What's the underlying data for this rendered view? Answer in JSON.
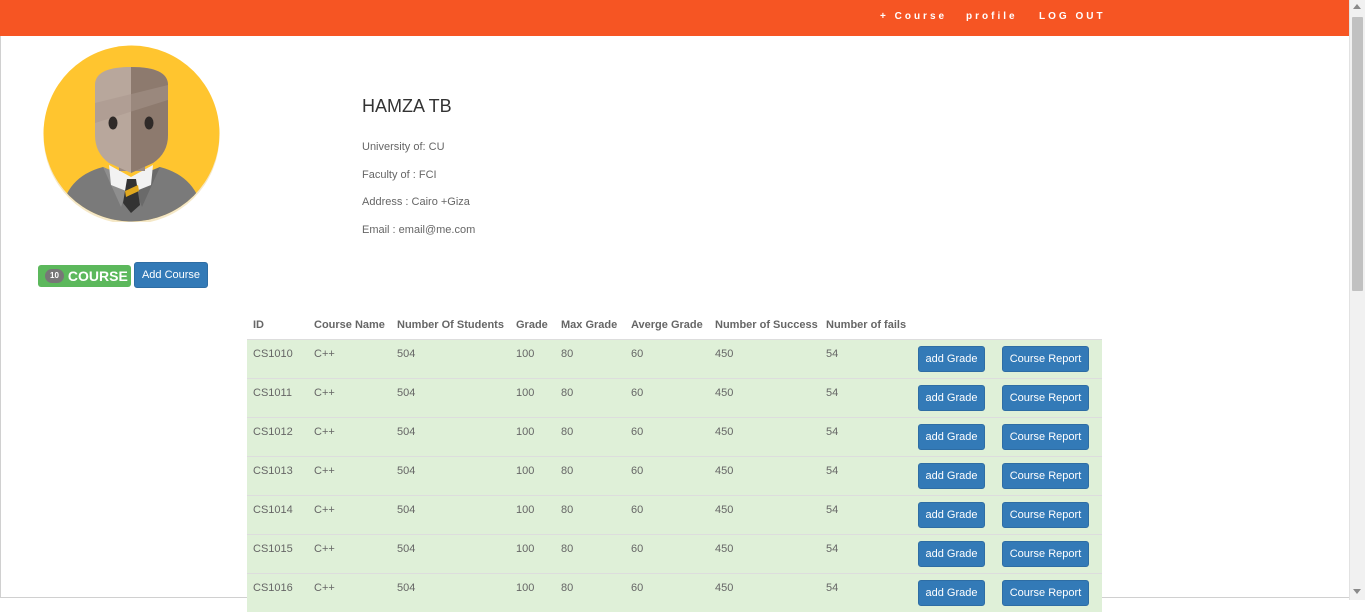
{
  "nav": {
    "items": [
      "+ Course",
      "profile",
      "LOG OUT"
    ]
  },
  "profile": {
    "name": "HAMZA TB",
    "university": "University of: CU",
    "faculty": "Faculty of : FCI",
    "address": "Address : Cairo +Giza",
    "email": "Email : email@me.com"
  },
  "courses_badge": {
    "count": "10",
    "label": "COURSE"
  },
  "add_course_label": "Add Course",
  "table": {
    "headers": [
      "ID",
      "Course Name",
      "Number Of Students",
      "Grade",
      "Max Grade",
      "Averge Grade",
      "Number of Success",
      "Number of fails"
    ],
    "add_grade_label": "add Grade",
    "course_report_label": "Course Report",
    "rows": [
      {
        "id": "CS1010",
        "name": "C++",
        "students": "504",
        "grade": "100",
        "max": "80",
        "avg": "60",
        "success": "450",
        "fails": "54"
      },
      {
        "id": "CS1011",
        "name": "C++",
        "students": "504",
        "grade": "100",
        "max": "80",
        "avg": "60",
        "success": "450",
        "fails": "54"
      },
      {
        "id": "CS1012",
        "name": "C++",
        "students": "504",
        "grade": "100",
        "max": "80",
        "avg": "60",
        "success": "450",
        "fails": "54"
      },
      {
        "id": "CS1013",
        "name": "C++",
        "students": "504",
        "grade": "100",
        "max": "80",
        "avg": "60",
        "success": "450",
        "fails": "54"
      },
      {
        "id": "CS1014",
        "name": "C++",
        "students": "504",
        "grade": "100",
        "max": "80",
        "avg": "60",
        "success": "450",
        "fails": "54"
      },
      {
        "id": "CS1015",
        "name": "C++",
        "students": "504",
        "grade": "100",
        "max": "80",
        "avg": "60",
        "success": "450",
        "fails": "54"
      },
      {
        "id": "CS1016",
        "name": "C++",
        "students": "504",
        "grade": "100",
        "max": "80",
        "avg": "60",
        "success": "450",
        "fails": "54"
      }
    ]
  },
  "colors": {
    "navbar": "#f65523",
    "row_success": "#dff0d8",
    "primary_button": "#337ab7",
    "badge_green": "#5cb85c"
  },
  "icons": {
    "avatar": "user-avatar-icon"
  }
}
